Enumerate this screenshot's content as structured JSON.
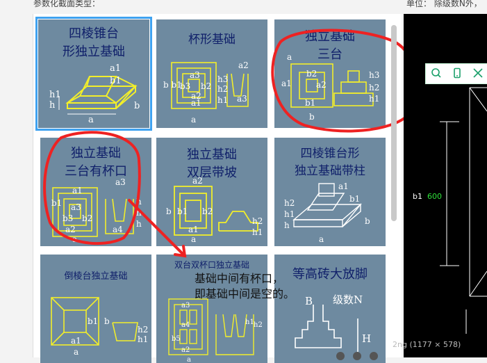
{
  "header": {
    "section_label": "参数化截面类型：",
    "unit_label": "单位： 除级数N外，"
  },
  "tiles": [
    {
      "title_lines": [
        "四棱锥台",
        "形独立基础"
      ],
      "dims": [
        "a1",
        "b1",
        "h1",
        "h",
        "a",
        "b"
      ]
    },
    {
      "title_lines": [
        "杯形基础"
      ],
      "dims": [
        "a2",
        "b b1",
        "b3",
        "a3",
        "b2",
        "a2",
        "h3",
        "h2",
        "h1",
        "a1",
        "a",
        "a3"
      ]
    },
    {
      "title_lines": [
        "独立基础",
        "三台"
      ],
      "dims": [
        "a",
        "b2",
        "a2",
        "a1",
        "h3",
        "h2",
        "h1",
        "b1",
        "b"
      ]
    },
    {
      "title_lines": [
        "独立基础",
        "三台有杯口"
      ],
      "dims": [
        "a3",
        "a1",
        "b1",
        "a3",
        "b3",
        "b2",
        "a2",
        "h",
        "h",
        "h",
        "a4",
        "a"
      ]
    },
    {
      "title_lines": [
        "独立基础",
        "双层带坡"
      ],
      "dims": [
        "a2",
        "b",
        "b1",
        "b2",
        "a1",
        "a",
        "h2",
        "h1"
      ]
    },
    {
      "title_lines": [
        "四棱锥台形",
        "独立基础带柱"
      ],
      "dims": [
        "a1",
        "b1",
        "h2",
        "h1",
        "h",
        "b",
        "a"
      ]
    },
    {
      "title_lines": [
        "倒棱台独立基础"
      ],
      "dims": [
        "b1",
        "a1",
        "a",
        "b",
        "h2",
        "h1"
      ]
    },
    {
      "title_lines": [
        "双台双杯口独立基础"
      ],
      "dims": [
        "a3",
        "a4",
        "b5",
        "a2",
        "h1",
        "h2",
        "a"
      ]
    },
    {
      "title_lines": [
        "等高砖大放脚"
      ],
      "dims": [
        "B",
        "级数N",
        "H"
      ]
    }
  ],
  "annotation": {
    "line1": "基础中间有杯口，",
    "line2": "即基础中间是空的。"
  },
  "cad": {
    "label": "b1",
    "value": "600",
    "image_info": "2ng (1177 × 578)"
  },
  "toolbar": {
    "icons": [
      "search-icon",
      "phone-icon",
      "expand-icon"
    ]
  },
  "colors": {
    "tile_bg": "#6e8aa0",
    "title_blue": "#10206a",
    "drawing_yellow": "#f2ee2a",
    "highlight_red": "#ee2222",
    "selection_blue": "#3fa2f0",
    "cad_green": "#2ee03a"
  }
}
